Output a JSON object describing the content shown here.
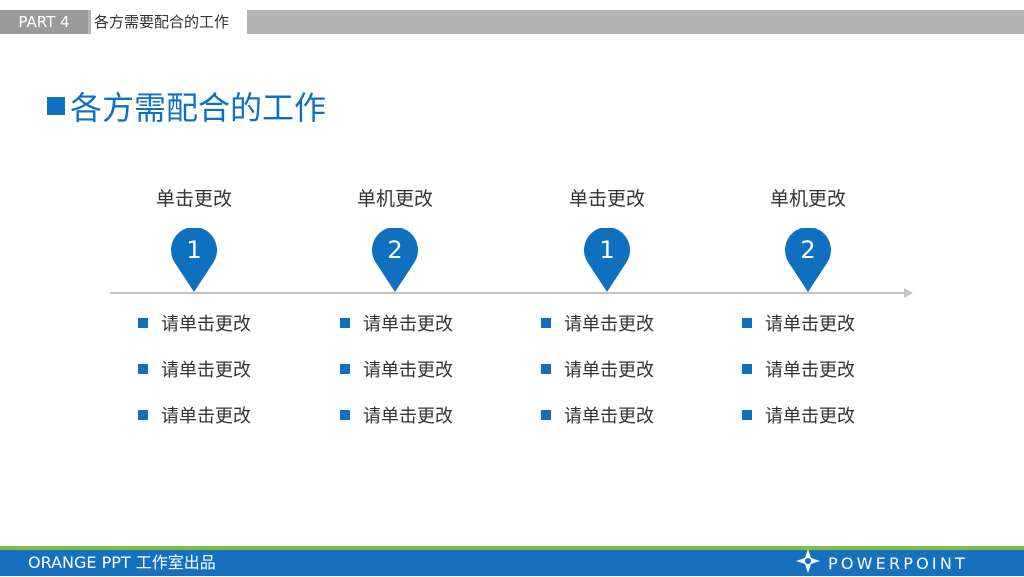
{
  "header": {
    "part_label": "PART 4",
    "section_label": "各方需要配合的工作"
  },
  "title": {
    "text": "各方需配合的工作"
  },
  "columns": [
    {
      "heading": "单击更改",
      "number": "1",
      "items": [
        "请单击更改",
        "请单击更改",
        "请单击更改"
      ]
    },
    {
      "heading": "单机更改",
      "number": "2",
      "items": [
        "请单击更改",
        "请单击更改",
        "请单击更改"
      ]
    },
    {
      "heading": "单击更改",
      "number": "1",
      "items": [
        "请单击更改",
        "请单击更改",
        "请单击更改"
      ]
    },
    {
      "heading": "单机更改",
      "number": "2",
      "items": [
        "请单击更改",
        "请单击更改",
        "请单击更改"
      ]
    }
  ],
  "footer": {
    "studio_text": "ORANGE PPT 工作室出品",
    "brand_text": "POWERPOINT",
    "brand_icon": "compass-star-icon"
  },
  "colors": {
    "accent_blue": "#0f70c0",
    "footer_blue": "#1570bf",
    "footer_green": "#7bbf45",
    "header_gray": "#b3b3b3"
  }
}
